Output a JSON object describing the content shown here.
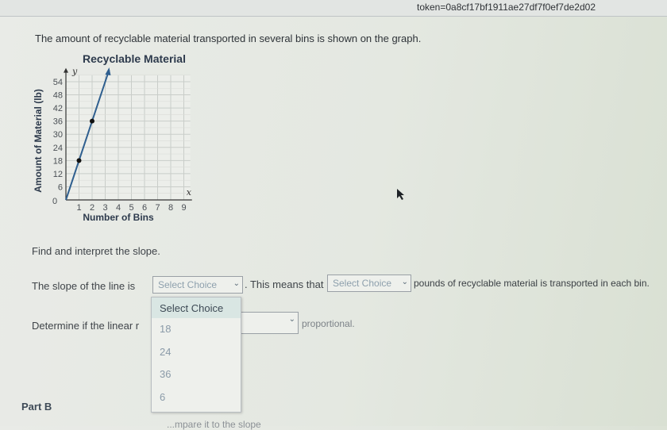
{
  "browser": {
    "url_fragment": "token=0a8cf17bf1911ae27df7f0ef7de2d02"
  },
  "question": {
    "intro": "The amount of recyclable material transported in several bins is shown on the graph.",
    "prompt": "Find and interpret the slope.",
    "sentence1_before": "The slope of the line is",
    "sentence1_middle": ". This means that",
    "sentence1_after": "pounds of recyclable material is transported in each bin.",
    "sentence2_before": "Determine if the linear r",
    "sentence2_after": "proportional.",
    "part_b_label": "Part B",
    "part_b_cutoff": "...mpare it to the slope"
  },
  "selects": {
    "slope": {
      "value": "Select Choice",
      "open": true
    },
    "interpretation": {
      "value": "Select Choice"
    },
    "proportional": {
      "value": ""
    }
  },
  "dropdown": {
    "options": [
      "Select Choice",
      "18",
      "24",
      "36",
      "6"
    ],
    "highlighted": "Select Choice"
  },
  "chart_data": {
    "type": "line",
    "title": "Recyclable Material",
    "xlabel": "Number of Bins",
    "ylabel": "Amount of Material (lb)",
    "x_axis_letter": "x",
    "y_axis_letter": "y",
    "xlim": [
      0,
      9.5
    ],
    "ylim": [
      0,
      57
    ],
    "x_ticks": [
      "0",
      "1",
      "2",
      "3",
      "4",
      "5",
      "6",
      "7",
      "8",
      "9"
    ],
    "y_ticks": [
      "6",
      "12",
      "18",
      "24",
      "30",
      "36",
      "42",
      "48",
      "54"
    ],
    "grid": true,
    "series": [
      {
        "line": [
          [
            0,
            0
          ],
          [
            3.3,
            59.4
          ]
        ],
        "points": [
          [
            1,
            18
          ],
          [
            2,
            36
          ]
        ],
        "color": "#2f5f8f"
      }
    ]
  }
}
